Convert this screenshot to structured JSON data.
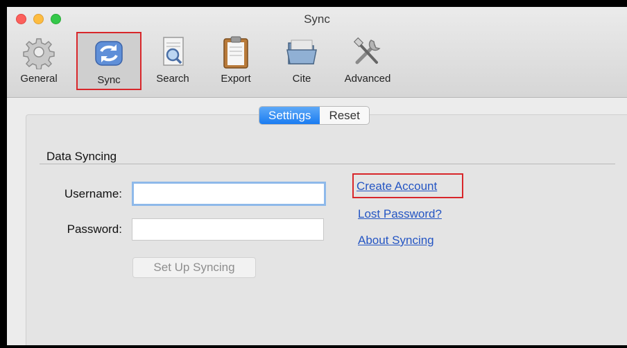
{
  "window": {
    "title": "Sync"
  },
  "toolbar": {
    "items": [
      {
        "label": "General",
        "icon": "gear-icon"
      },
      {
        "label": "Sync",
        "icon": "sync-arrows-icon",
        "selected": true
      },
      {
        "label": "Search",
        "icon": "search-document-icon"
      },
      {
        "label": "Export",
        "icon": "clipboard-icon"
      },
      {
        "label": "Cite",
        "icon": "folder-icon"
      },
      {
        "label": "Advanced",
        "icon": "tools-icon"
      }
    ]
  },
  "tabs": {
    "settings": "Settings",
    "reset": "Reset",
    "active": "Settings"
  },
  "data_syncing": {
    "section_title": "Data Syncing",
    "username_label": "Username:",
    "username_value": "",
    "password_label": "Password:",
    "password_value": "",
    "setup_button": "Set Up Syncing"
  },
  "links": {
    "create_account": "Create Account",
    "lost_password": "Lost Password?",
    "about_syncing": "About Syncing"
  },
  "colors": {
    "accent_blue": "#1a7cf1",
    "link_blue": "#2455c3",
    "highlight_red": "#d8262a"
  }
}
